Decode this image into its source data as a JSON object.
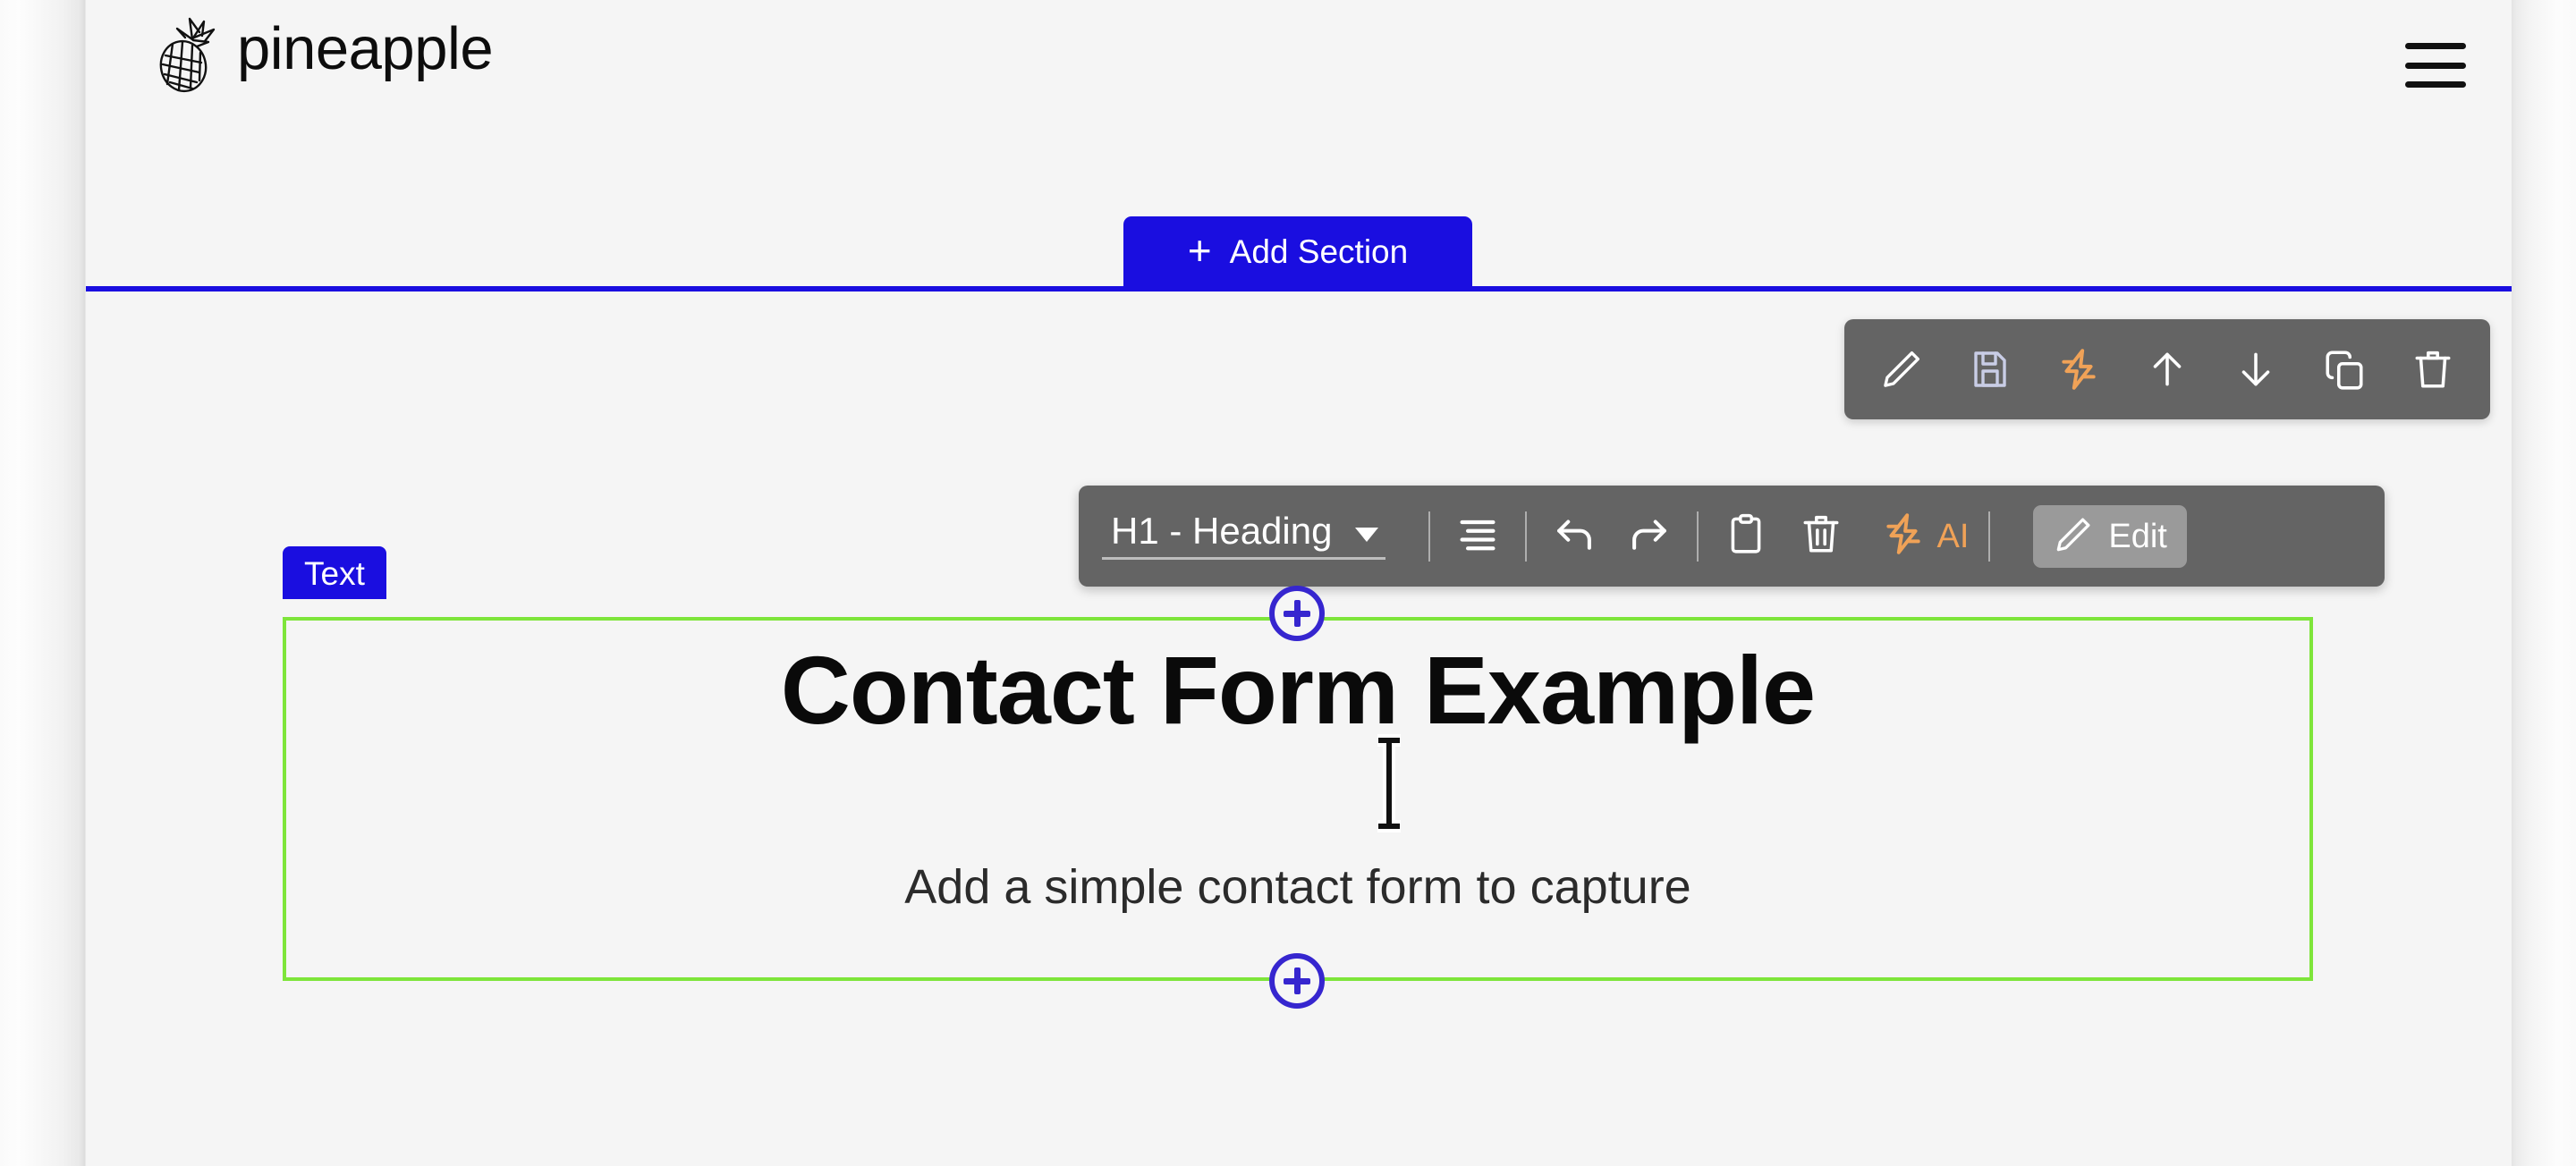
{
  "app": {
    "brand_name": "pineapple",
    "logo_icon": "pineapple-icon",
    "menu_icon": "hamburger-menu-icon"
  },
  "add_section": {
    "label": "Add Section",
    "plus_glyph": "+",
    "icon": "plus-icon",
    "accent_color": "#1a0ee0"
  },
  "section_toolbar": {
    "background": "#646464",
    "items": [
      {
        "icon": "pencil-edit-icon",
        "name": "edit-section",
        "color": "#ffffff"
      },
      {
        "icon": "floppy-save-icon",
        "name": "save-section",
        "color": "#c9cde6"
      },
      {
        "icon": "lightning-ai-icon",
        "name": "ai-section",
        "color": "#f0a257"
      },
      {
        "icon": "arrow-up-icon",
        "name": "move-section-up",
        "color": "#ffffff"
      },
      {
        "icon": "arrow-down-icon",
        "name": "move-section-down",
        "color": "#ffffff"
      },
      {
        "icon": "copy-duplicate-icon",
        "name": "duplicate-section",
        "color": "#ffffff"
      },
      {
        "icon": "trash-delete-icon",
        "name": "delete-section",
        "color": "#ffffff"
      }
    ]
  },
  "text_toolbar": {
    "background": "#646464",
    "style_select": {
      "value": "H1 - Heading",
      "caret_icon": "chevron-down-icon"
    },
    "align_icon": "text-align-icon",
    "undo_icon": "undo-arrow-icon",
    "redo_icon": "redo-arrow-icon",
    "paste_icon": "clipboard-paste-icon",
    "delete_icon": "trash-delete-icon",
    "ai": {
      "icon": "lightning-ai-icon",
      "label": "AI",
      "color": "#f0a257"
    },
    "edit_button": {
      "icon": "pencil-edit-icon",
      "label": "Edit",
      "background": "#9a9a9a"
    }
  },
  "selected_block": {
    "badge_label": "Text",
    "badge_color": "#1a0ee0",
    "outline_color": "#7ee53a",
    "heading": "Contact Form Example",
    "subtitle": "Add a simple contact form to capture",
    "handle_icon": "plus-circle-icon",
    "handle_color": "#3626cf"
  },
  "cursor": {
    "type": "text-ibeam-cursor"
  }
}
